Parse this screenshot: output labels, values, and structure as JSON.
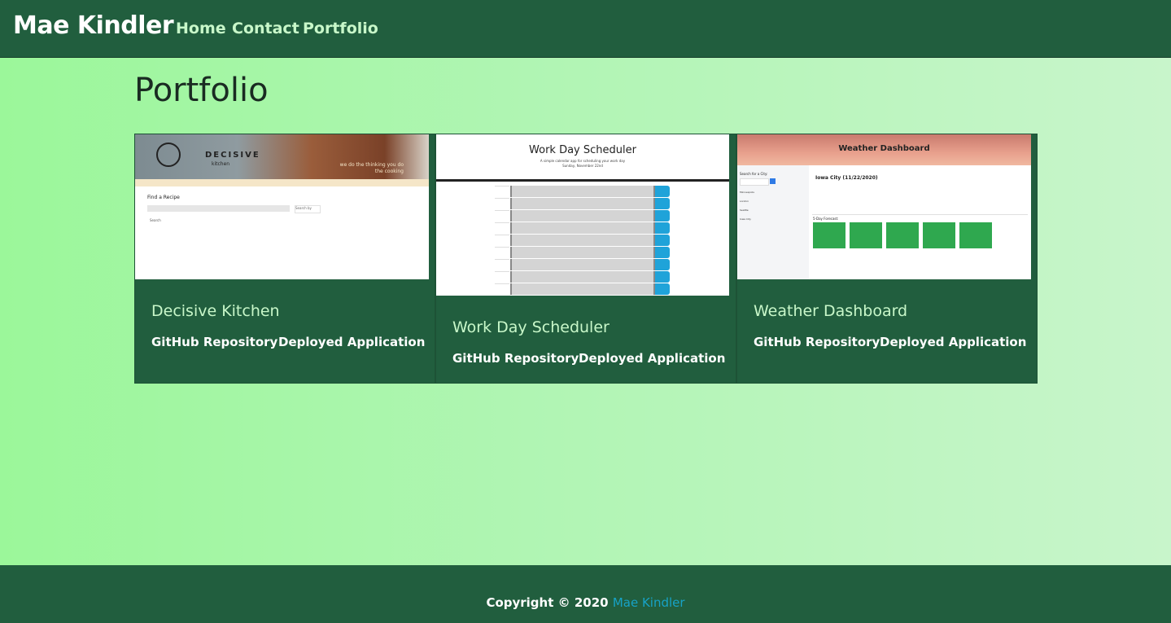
{
  "navbar": {
    "brand": "Mae Kindler",
    "links": [
      "Home",
      "Contact",
      "Portfolio"
    ]
  },
  "page": {
    "heading": "Portfolio"
  },
  "projects": [
    {
      "title": "Decisive Kitchen",
      "github_label": "GitHub Repository",
      "deploy_label": "Deployed Application",
      "thumb": {
        "logo_text": "DECISIVE",
        "sub_text": "kitchen",
        "tag_line": "we do the thinking you do the cooking",
        "search_label": "Find a Recipe",
        "search_button": "Search",
        "select_label": "Search by"
      }
    },
    {
      "title": "Work Day Scheduler",
      "github_label": "GitHub Repository",
      "deploy_label": "Deployed Application",
      "thumb": {
        "header": "Work Day Scheduler",
        "subheader": "A simple calendar app for scheduling your work day",
        "date": "Sunday, November 22nd"
      }
    },
    {
      "title": "Weather Dashboard",
      "github_label": "GitHub Repository",
      "deploy_label": "Deployed Application",
      "thumb": {
        "header": "Weather Dashboard",
        "search_label": "Search for a City:",
        "city": "Iowa City (11/22/2020)",
        "forecast_label": "5-Day Forecast:",
        "cities": [
          "Minneapolis",
          "London",
          "Seattle",
          "Iowa City"
        ]
      }
    }
  ],
  "footer": {
    "prefix": "Copyright © 2020",
    "author": "Mae Kindler"
  },
  "colors": {
    "nav_bg": "#215e3e",
    "card_title": "#c8f7c9",
    "link_accent": "#17a2c6"
  }
}
